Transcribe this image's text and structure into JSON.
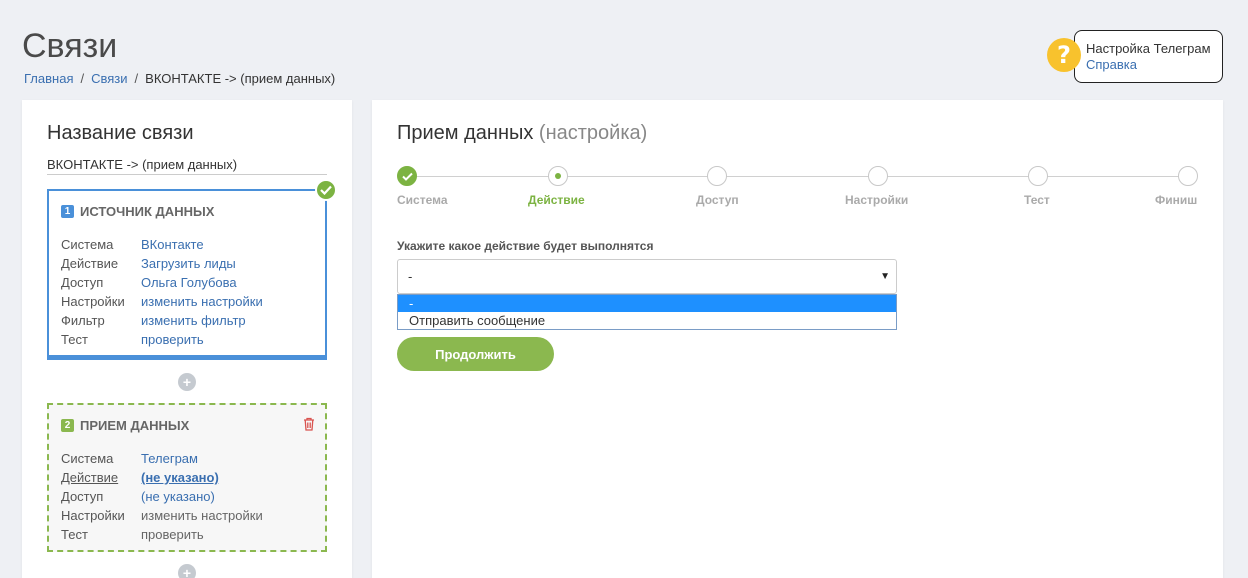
{
  "page": {
    "title": "Связи"
  },
  "breadcrumb": {
    "home": "Главная",
    "connections": "Связи",
    "current": "ВКОНТАКТЕ -> (прием данных)"
  },
  "help": {
    "title": "Настройка Телеграм",
    "link": "Справка",
    "icon": "question-icon"
  },
  "left": {
    "heading": "Название связи",
    "connection_name": "ВКОНТАКТЕ -> (прием данных)",
    "source": {
      "number": "1",
      "title": "ИСТОЧНИК ДАННЫХ",
      "rows": [
        {
          "key": "Система",
          "value": "ВКонтакте"
        },
        {
          "key": "Действие",
          "value": "Загрузить лиды"
        },
        {
          "key": "Доступ",
          "value": "Ольга Голубова"
        },
        {
          "key": "Настройки",
          "value": "изменить настройки"
        },
        {
          "key": "Фильтр",
          "value": "изменить фильтр"
        },
        {
          "key": "Тест",
          "value": "проверить"
        }
      ]
    },
    "receiver": {
      "number": "2",
      "title": "ПРИЕМ ДАННЫХ",
      "rows": [
        {
          "key": "Система",
          "value": "Телеграм"
        },
        {
          "key": "Действие",
          "value": "(не указано)"
        },
        {
          "key": "Доступ",
          "value": "(не указано)"
        },
        {
          "key": "Настройки",
          "value": "изменить настройки"
        },
        {
          "key": "Тест",
          "value": "проверить"
        }
      ]
    },
    "add_symbol": "+"
  },
  "main": {
    "heading": "Прием данных",
    "heading_sub": "(настройка)",
    "steps": [
      {
        "label": "Система",
        "state": "done"
      },
      {
        "label": "Действие",
        "state": "active"
      },
      {
        "label": "Доступ",
        "state": "pending"
      },
      {
        "label": "Настройки",
        "state": "pending"
      },
      {
        "label": "Тест",
        "state": "pending"
      },
      {
        "label": "Финиш",
        "state": "pending"
      }
    ],
    "action_label": "Укажите какое действие будет выполнятся",
    "select_value": "-",
    "options": [
      "-",
      "Отправить сообщение"
    ],
    "continue": "Продолжить"
  },
  "colors": {
    "accent_green": "#8bb84f",
    "accent_blue": "#4a90d9",
    "link": "#3a6fb0",
    "help_yellow": "#f8c22d"
  }
}
